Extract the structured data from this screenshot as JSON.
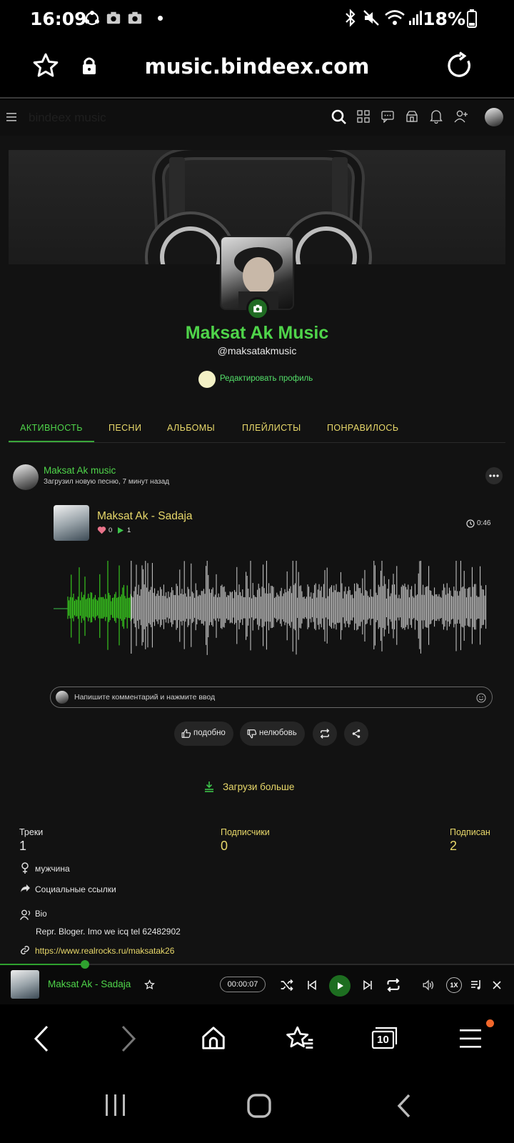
{
  "status_bar": {
    "time": "16:09",
    "battery": "18%"
  },
  "browser": {
    "url": "music.bindeex.com",
    "tab_count": "10"
  },
  "site": {
    "title": "bindeex music"
  },
  "profile": {
    "name": "Maksat Ak Music",
    "handle": "@maksatakmusic",
    "edit_label": "Редактировать профиль"
  },
  "tabs": [
    {
      "label": "АКТИВНОСТЬ",
      "active": true
    },
    {
      "label": "ПЕСНИ"
    },
    {
      "label": "АЛЬБОМЫ"
    },
    {
      "label": "ПЛЕЙЛИСТЫ"
    },
    {
      "label": "ПОНРАВИЛОСЬ"
    }
  ],
  "post": {
    "author": "Maksat Ak music",
    "meta": "Загрузил новую песню, 7 минут назад",
    "track": {
      "title": "Maksat Ak - Sadaja",
      "likes": "0",
      "plays": "1",
      "duration": "0:46",
      "played_fraction": 0.15
    },
    "comment_placeholder": "Напишите комментарий и нажмите ввод",
    "actions": {
      "like": "подобно",
      "dislike": "нелюбовь"
    }
  },
  "load_more": "Загрузи больше",
  "stats": [
    {
      "label": "Треки",
      "value": "1"
    },
    {
      "label": "Подписчики",
      "value": "0"
    },
    {
      "label": "Подписан",
      "value": "2"
    }
  ],
  "info": {
    "gender": "мужчина",
    "social_links": "Социальные ссылки",
    "bio_label": "Bio",
    "bio_text": "Repr. Bloger. Imo we icq tel 62482902",
    "website": "https://www.realrocks.ru/maksatak26"
  },
  "player": {
    "title": "Maksat Ak - Sadaja",
    "time": "00:00:07",
    "speed": "1X",
    "progress": 0.165
  },
  "colors": {
    "accent_green": "#4fd44a",
    "accent_yellow": "#e8d86a",
    "background": "#121212"
  }
}
